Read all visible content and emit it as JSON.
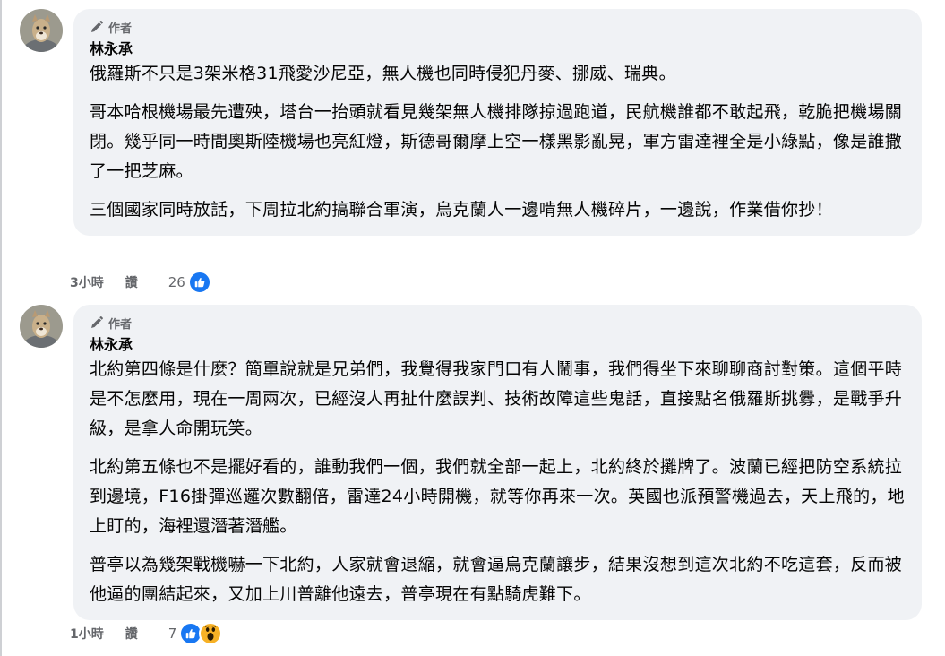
{
  "colors": {
    "bubble": "#f0f2f5",
    "meta_text": "#65676b",
    "like_blue": "#1877f2",
    "wow_yellow": "#f7b125"
  },
  "comments": [
    {
      "badge": "作者",
      "badge_icon": "pencil-icon",
      "author": "林永承",
      "paragraphs": [
        "俄羅斯不只是3架米格31飛愛沙尼亞，無人機也同時侵犯丹麥、挪威、瑞典。",
        "哥本哈根機場最先遭殃，塔台一抬頭就看見幾架無人機排隊掠過跑道，民航機誰都不敢起飛，乾脆把機場關閉。幾乎同一時間奧斯陸機場也亮紅燈，斯德哥爾摩上空一樣黑影亂晃，軍方雷達裡全是小綠點，像是誰撒了一把芝麻。",
        "三個國家同時放話，下周拉北約搞聯合軍演，烏克蘭人一邊啃無人機碎片，一邊說，作業借你抄！"
      ],
      "time": "3小時",
      "like_label": "讚",
      "reaction_count": "26",
      "reactions": [
        "like-icon"
      ]
    },
    {
      "badge": "作者",
      "badge_icon": "pencil-icon",
      "author": "林永承",
      "paragraphs": [
        "北約第四條是什麼？簡單說就是兄弟們，我覺得我家門口有人鬧事，我們得坐下來聊聊商討對策。這個平時是不怎麼用，現在一周兩次，已經沒人再扯什麼誤判、技術故障這些鬼話，直接點名俄羅斯挑釁，是戰爭升級，是拿人命開玩笑。",
        "北約第五條也不是擺好看的，誰動我們一個，我們就全部一起上，北約終於攤牌了。波蘭已經把防空系統拉到邊境，F16掛彈巡邏次數翻倍，雷達24小時開機，就等你再來一次。英國也派預警機過去，天上飛的，地上盯的，海裡還潛著潛艦。",
        "普亭以為幾架戰機嚇一下北約，人家就會退縮，就會逼烏克蘭讓步，結果沒想到這次北約不吃這套，反而被他逼的團結起來，又加上川普離他遠去，普亭現在有點騎虎難下。"
      ],
      "time": "1小時",
      "like_label": "讚",
      "reaction_count": "7",
      "reactions": [
        "like-icon",
        "wow-icon"
      ]
    }
  ]
}
